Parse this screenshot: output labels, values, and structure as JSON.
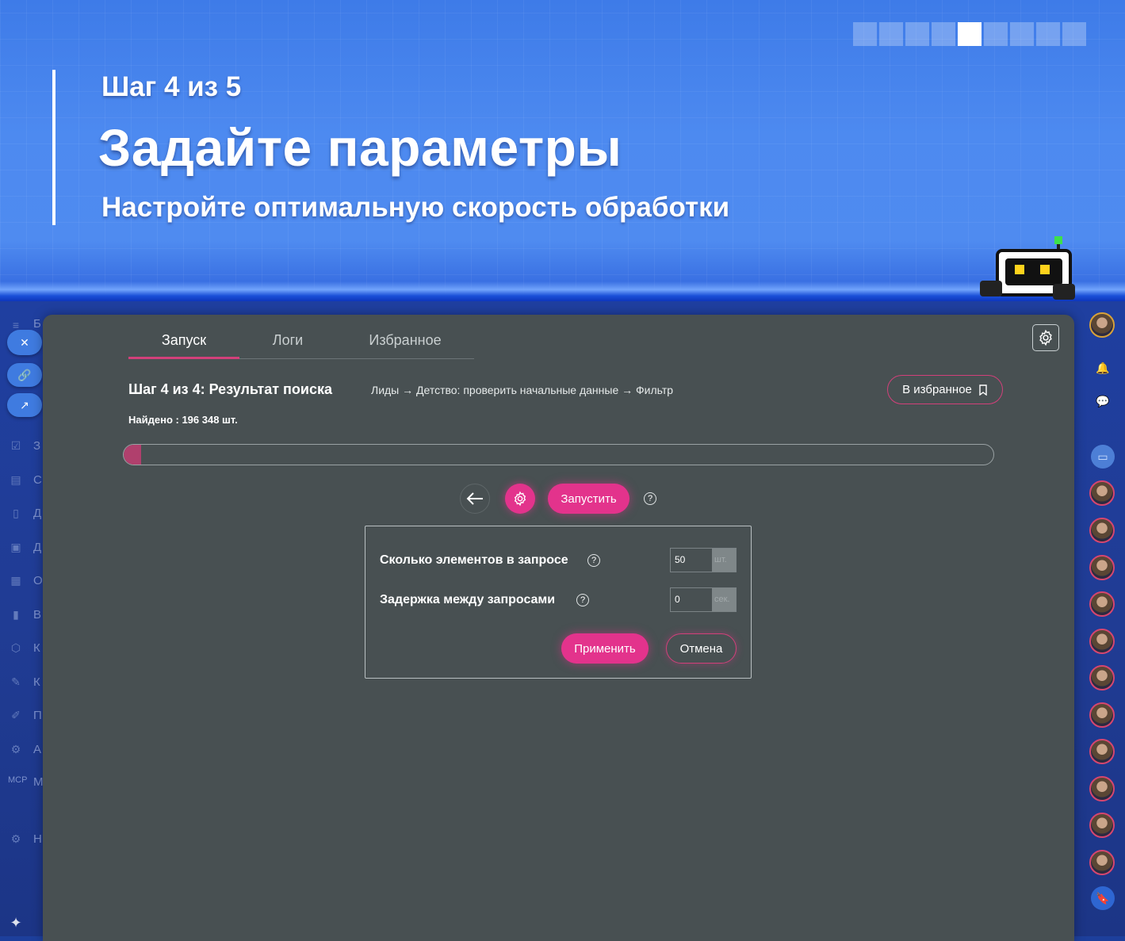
{
  "banner": {
    "step": "Шаг 4 из 5",
    "title": "Задайте параметры",
    "subtitle": "Настройте оптимальную скорость обработки",
    "stepper_total": 9,
    "stepper_active": 5
  },
  "colors": {
    "accent": "#e3338c",
    "panel": "#485052",
    "banner": "#4d8af0"
  },
  "left_rail": {
    "letters": [
      "Б",
      "З",
      "С",
      "Д",
      "Д",
      "О",
      "В",
      "К",
      "К",
      "П",
      "А",
      "М",
      "Н"
    ]
  },
  "tabs": [
    {
      "label": "Запуск",
      "active": true
    },
    {
      "label": "Логи",
      "active": false
    },
    {
      "label": "Избранное",
      "active": false
    }
  ],
  "header": {
    "step_title": "Шаг 4 из 4: Результат поиска",
    "breadcrumb": "Лиды → Детство: проверить начальные данные → Фильтр",
    "favorite_label": "В избранное"
  },
  "found": {
    "text": "Найдено : 196 348 шт."
  },
  "progress": {
    "percent": 2
  },
  "actions": {
    "run_label": "Запустить",
    "help": "?"
  },
  "settings": {
    "batch_label": "Сколько элементов в запросе",
    "batch_value": "50",
    "batch_unit": "шт.",
    "delay_label": "Задержка между запросами",
    "delay_value": "0",
    "delay_unit": "сек.",
    "apply_label": "Применить",
    "cancel_label": "Отмена"
  }
}
